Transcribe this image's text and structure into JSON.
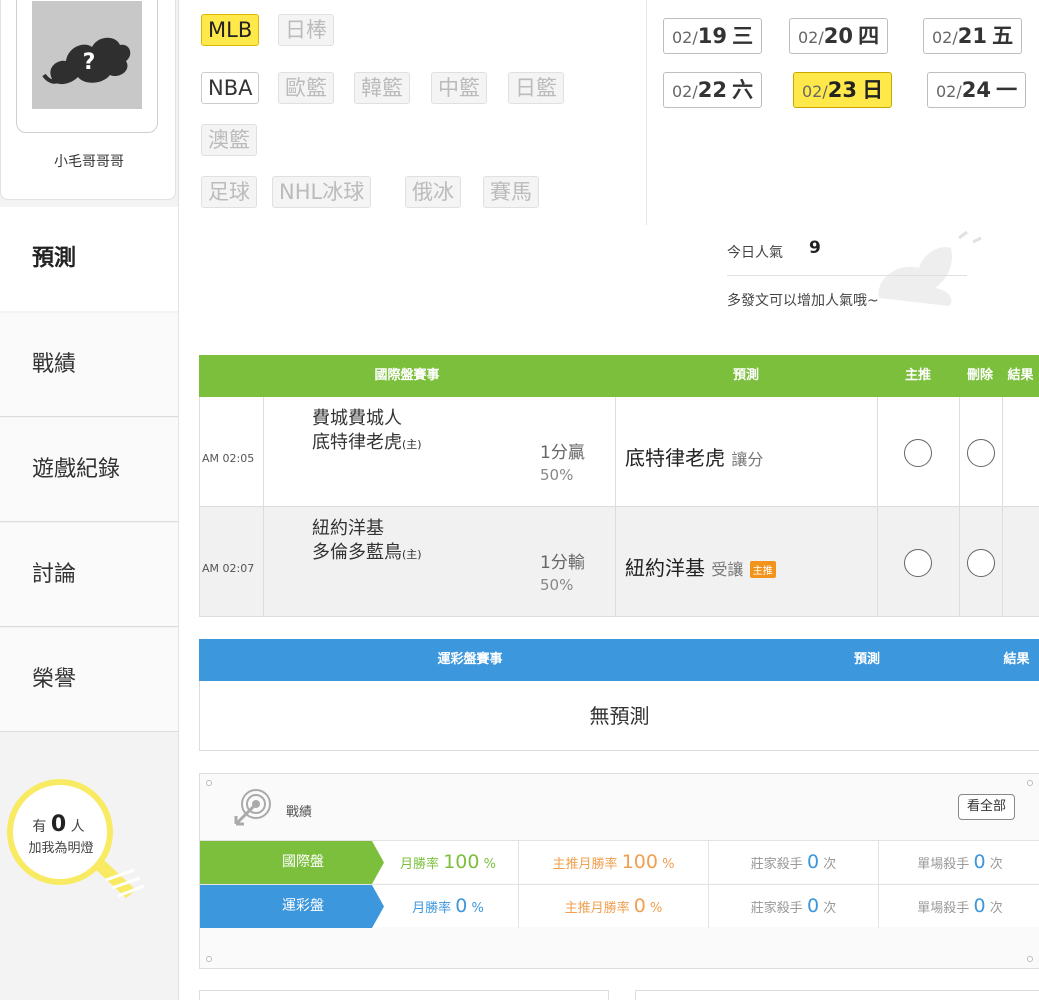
{
  "user": {
    "name": "小毛哥哥哥"
  },
  "nav": [
    {
      "label": "預測"
    },
    {
      "label": "戰績"
    },
    {
      "label": "遊戲紀錄"
    },
    {
      "label": "討論"
    },
    {
      "label": "榮譽"
    }
  ],
  "bulb": {
    "prefix": "有",
    "count": "0",
    "suffix": "人",
    "line2": "加我為明燈"
  },
  "sports": {
    "row1": [
      "MLB",
      "日棒"
    ],
    "row2": [
      "NBA",
      "歐籃",
      "韓籃",
      "中籃",
      "日籃"
    ],
    "row3": [
      "澳籃"
    ],
    "row4": [
      "足球",
      "NHL冰球",
      "俄冰",
      "賽馬"
    ]
  },
  "dates": [
    {
      "md": "02/",
      "day": "19",
      "wd": "三"
    },
    {
      "md": "02/",
      "day": "20",
      "wd": "四"
    },
    {
      "md": "02/",
      "day": "21",
      "wd": "五"
    },
    {
      "md": "02/",
      "day": "22",
      "wd": "六"
    },
    {
      "md": "02/",
      "day": "23",
      "wd": "日"
    },
    {
      "md": "02/",
      "day": "24",
      "wd": "一"
    }
  ],
  "popularity": {
    "label": "今日人氣",
    "value": "9",
    "tip": "多發文可以增加人氣哦~"
  },
  "intl_table": {
    "headers": [
      "國際盤賽事",
      "預測",
      "主推",
      "刪除",
      "結果"
    ],
    "rows": [
      {
        "time": "AM 02:05",
        "team1": "費城費城人",
        "team2": "底特律老虎",
        "home": "(主)",
        "result": "1分贏",
        "pct": "50%",
        "pick": "底特律老虎",
        "pick_type": "讓分",
        "badge": ""
      },
      {
        "time": "AM 02:07",
        "team1": "紐約洋基",
        "team2": "多倫多藍鳥",
        "home": "(主)",
        "result": "1分輸",
        "pct": "50%",
        "pick": "紐約洋基",
        "pick_type": "受讓",
        "badge": "主推"
      }
    ]
  },
  "lottery_table": {
    "headers": [
      "運彩盤賽事",
      "預測",
      "結果"
    ],
    "empty": "無預測"
  },
  "record": {
    "title": "戰績",
    "view_all": "看全部",
    "rows": [
      {
        "label": "國際盤",
        "month_label": "月勝率",
        "month_val": "100",
        "main_label": "主推月勝率",
        "main_val": "100",
        "pct": "%",
        "killer_label": "莊家殺手",
        "killer_val": "0",
        "single_label": "單場殺手",
        "single_val": "0",
        "unit": "次"
      },
      {
        "label": "運彩盤",
        "month_label": "月勝率",
        "month_val": "0",
        "main_label": "主推月勝率",
        "main_val": "0",
        "pct": "%",
        "killer_label": "莊家殺手",
        "killer_val": "0",
        "single_label": "單場殺手",
        "single_val": "0",
        "unit": "次"
      }
    ]
  },
  "colors": {
    "green": "#7cbf3c",
    "blue": "#3d97dd",
    "yellow": "#ffe94a",
    "orange": "#f2941b"
  }
}
